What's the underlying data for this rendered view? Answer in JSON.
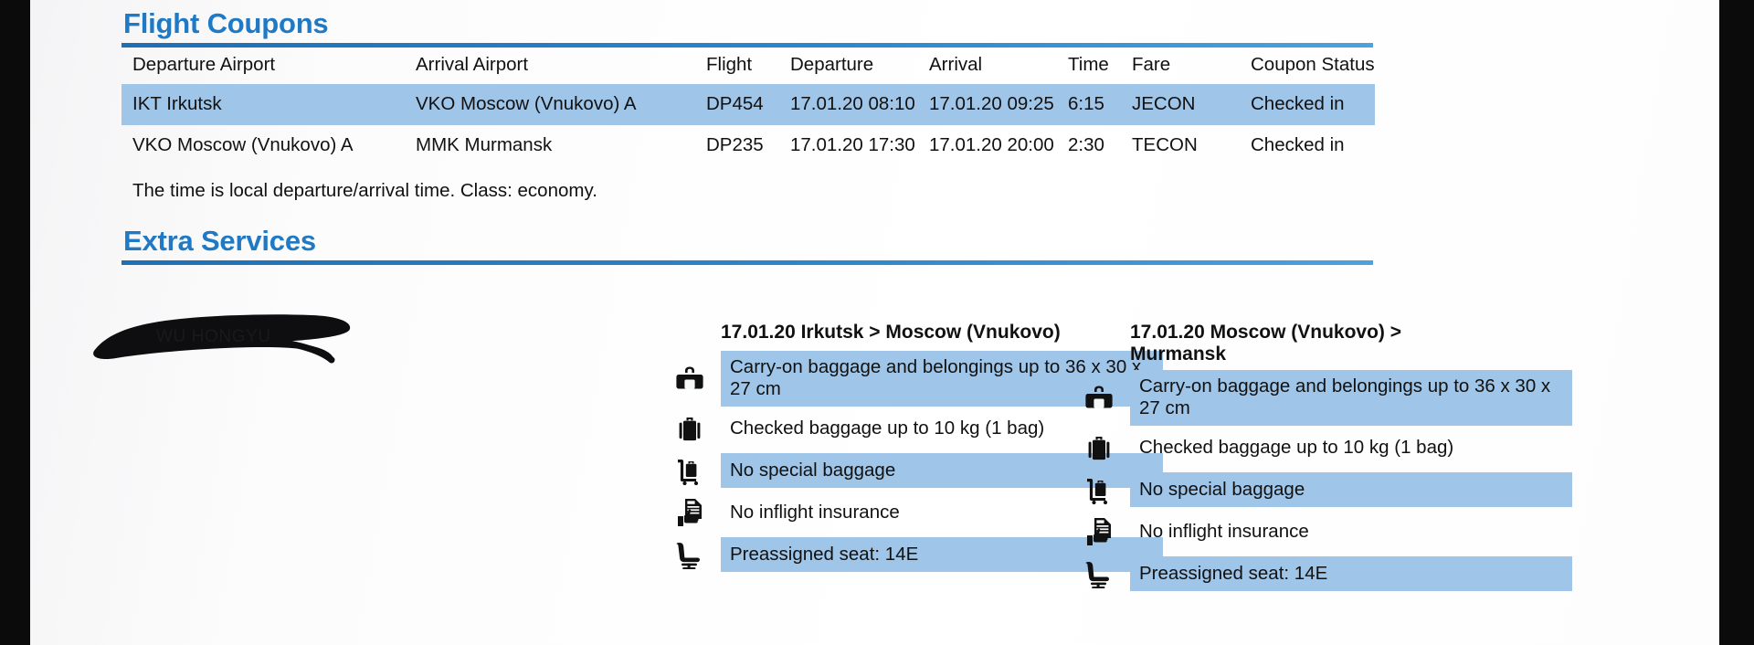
{
  "document": {
    "flight_coupons": {
      "title": "Flight Coupons",
      "columns": [
        "Departure Airport",
        "Arrival Airport",
        "Flight",
        "Departure",
        "Arrival",
        "Time",
        "Fare",
        "Coupon Status"
      ],
      "rows": [
        {
          "departure_airport": "IKT Irkutsk",
          "arrival_airport": "VKO Moscow (Vnukovo) A",
          "flight": "DP454",
          "departure": "17.01.20 08:10",
          "arrival": "17.01.20 09:25",
          "time": "6:15",
          "fare": "JECON",
          "coupon_status": "Checked in",
          "highlighted": true
        },
        {
          "departure_airport": "VKO Moscow (Vnukovo) A",
          "arrival_airport": "MMK Murmansk",
          "flight": "DP235",
          "departure": "17.01.20 17:30",
          "arrival": "17.01.20 20:00",
          "time": "2:30",
          "fare": "TECON",
          "coupon_status": "Checked in",
          "highlighted": false
        }
      ],
      "note": "The time is local departure/arrival time. Class: economy."
    },
    "extra_services": {
      "title": "Extra Services",
      "redacted_passenger_name": "WU HONGYU",
      "columns": [
        {
          "heading": "17.01.20 Irkutsk > Moscow (Vnukovo)",
          "services": [
            {
              "icon": "duffel-bag-icon",
              "text": "Carry-on baggage and belongings up to 36 x 30 x 27 cm",
              "highlighted": true
            },
            {
              "icon": "suitcase-icon",
              "text": "Checked baggage up to 10 kg (1 bag)",
              "highlighted": false
            },
            {
              "icon": "baggage-cart-icon",
              "text": "No special baggage",
              "highlighted": true
            },
            {
              "icon": "insurance-document-icon",
              "text": "No inflight insurance",
              "highlighted": false
            },
            {
              "icon": "seat-icon",
              "text": "Preassigned seat: 14E",
              "highlighted": true
            }
          ]
        },
        {
          "heading": "17.01.20 Moscow (Vnukovo) > Murmansk",
          "services": [
            {
              "icon": "duffel-bag-icon",
              "text": "Carry-on baggage and belongings up to 36 x 30 x 27 cm",
              "highlighted": true
            },
            {
              "icon": "suitcase-icon",
              "text": "Checked baggage up to 10 kg (1 bag)",
              "highlighted": false
            },
            {
              "icon": "baggage-cart-icon",
              "text": "No special baggage",
              "highlighted": true
            },
            {
              "icon": "insurance-document-icon",
              "text": "No inflight insurance",
              "highlighted": false
            },
            {
              "icon": "seat-icon",
              "text": "Preassigned seat: 14E",
              "highlighted": true
            }
          ]
        }
      ]
    },
    "colors": {
      "heading_blue": "#2079c4",
      "rule_blue": "#2a86cd",
      "row_highlight": "#9fc5e8",
      "page_background": "#fbfbfb",
      "text": "#111111"
    }
  }
}
